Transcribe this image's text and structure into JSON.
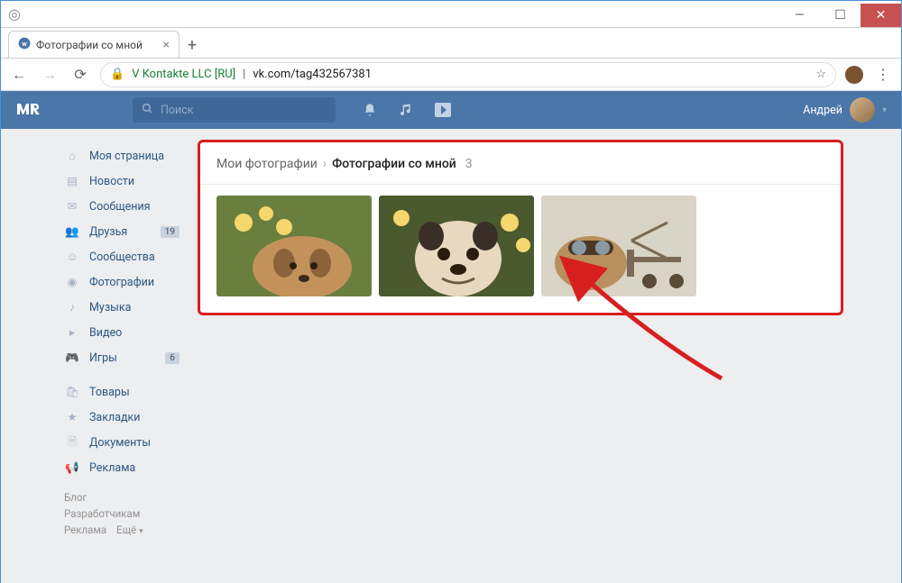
{
  "browser": {
    "tab_title": "Фотографии со мной",
    "address_company": "V Kontakte LLC [RU]",
    "address_url": "vk.com/tag432567381"
  },
  "vk_header": {
    "search_placeholder": "Поиск",
    "username": "Андрей"
  },
  "sidebar": {
    "items": [
      {
        "label": "Моя страница",
        "icon": "home"
      },
      {
        "label": "Новости",
        "icon": "news"
      },
      {
        "label": "Сообщения",
        "icon": "messages"
      },
      {
        "label": "Друзья",
        "icon": "friends",
        "badge": "19"
      },
      {
        "label": "Сообщества",
        "icon": "groups"
      },
      {
        "label": "Фотографии",
        "icon": "photos"
      },
      {
        "label": "Музыка",
        "icon": "music"
      },
      {
        "label": "Видео",
        "icon": "video"
      },
      {
        "label": "Игры",
        "icon": "games",
        "badge": "6"
      }
    ],
    "items2": [
      {
        "label": "Товары",
        "icon": "market"
      },
      {
        "label": "Закладки",
        "icon": "bookmarks"
      },
      {
        "label": "Документы",
        "icon": "docs"
      },
      {
        "label": "Реклама",
        "icon": "ads"
      }
    ],
    "footer": {
      "blog": "Блог",
      "devs": "Разработчикам",
      "ads": "Реклама",
      "more": "Ещё"
    }
  },
  "breadcrumb": {
    "root": "Мои фотографии",
    "current": "Фотографии со мной",
    "count": "3"
  }
}
